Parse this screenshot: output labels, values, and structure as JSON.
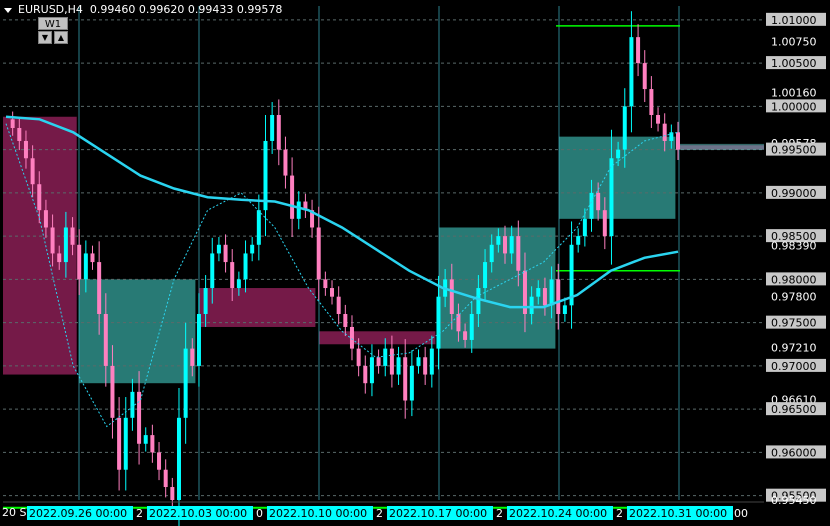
{
  "header": {
    "symbol": "EURUSD,H4",
    "ohlc": "0.99460 0.99620 0.99433 0.99578"
  },
  "timeframe_button": {
    "label": "W1",
    "down_icon": "arrow-down-icon",
    "up_icon": "arrow-up-icon"
  },
  "colors": {
    "bull": "#00ffff",
    "bear": "#ff80c0",
    "ma_slow": "#2ad4f0",
    "ma_fast": "#2ad4f0",
    "box_bull": "#2f8f8a",
    "box_bear": "#8a1f55",
    "grid": "#5a6a6a",
    "vline": "#3fb8c8",
    "level_line": "#00ff00",
    "price_label_bg": "#c8c8c8",
    "time_label_bg": "#00ffff"
  },
  "price_axis": {
    "levels": [
      "1.01000",
      "1.00750",
      "1.00500",
      "1.00160",
      "1.00000",
      "0.99578",
      "0.99500",
      "0.99000",
      "0.98500",
      "0.98390",
      "0.98000",
      "0.97800",
      "0.97500",
      "0.97210",
      "0.97000",
      "0.96610",
      "0.96500",
      "0.96000",
      "0.95500",
      "0.95450"
    ],
    "highlighted": [
      "1.01000",
      "1.00500",
      "1.00000",
      "0.99500",
      "0.99000",
      "0.98500",
      "0.98000",
      "0.97500",
      "0.97000",
      "0.96500",
      "0.96000",
      "0.95500"
    ],
    "current": "0.99578"
  },
  "time_axis": {
    "left_fragment": "20 S",
    "labels": [
      "2022.09.26 00:00",
      "2022.10.03 00:00",
      "2022.10.10 00:00",
      "2022.10.17 00:00",
      "2022.10.24 00:00",
      "2022.10.31 00:00"
    ],
    "fragments": [
      "2",
      "0",
      "2",
      "2",
      "2"
    ],
    "right_fragment": "00"
  },
  "chart_data": {
    "type": "candlestick",
    "symbol": "EURUSD",
    "timeframe": "H4",
    "ylim": [
      0.9545,
      1.0116
    ],
    "weeks": [
      {
        "start": "2022.09.19",
        "open": 0.9988,
        "close": 0.969,
        "high": 1.005,
        "low": 0.954
      },
      {
        "start": "2022.09.26",
        "open": 0.968,
        "close": 0.98,
        "high": 1.0,
        "low": 0.9535
      },
      {
        "start": "2022.10.03",
        "open": 0.979,
        "close": 0.9745,
        "high": 0.9998,
        "low": 0.974
      },
      {
        "start": "2022.10.10",
        "open": 0.974,
        "close": 0.9725,
        "high": 0.981,
        "low": 0.963
      },
      {
        "start": "2022.10.17",
        "open": 0.972,
        "close": 0.986,
        "high": 0.9875,
        "low": 0.97
      },
      {
        "start": "2022.10.24",
        "open": 0.987,
        "close": 0.9965,
        "high": 1.0093,
        "low": 0.981
      },
      {
        "start": "2022.10.31",
        "open": 0.9955,
        "close": 0.995,
        "high": 0.9995,
        "low": 0.993
      }
    ],
    "w1_levels": [
      1.0093,
      0.981,
      0.9536
    ],
    "series_path": [
      0.9985,
      0.9975,
      0.996,
      0.994,
      0.991,
      0.988,
      0.986,
      0.983,
      0.982,
      0.986,
      0.984,
      0.98,
      0.983,
      0.982,
      0.976,
      0.97,
      0.964,
      0.958,
      0.964,
      0.967,
      0.961,
      0.962,
      0.96,
      0.958,
      0.956,
      0.9545,
      0.964,
      0.972,
      0.97,
      0.976,
      0.979,
      0.983,
      0.984,
      0.982,
      0.979,
      0.98,
      0.983,
      0.984,
      0.988,
      0.996,
      0.999,
      0.995,
      0.992,
      0.987,
      0.989,
      0.988,
      0.986,
      0.98,
      0.979,
      0.978,
      0.976,
      0.9745,
      0.972,
      0.97,
      0.968,
      0.971,
      0.97,
      0.972,
      0.969,
      0.971,
      0.966,
      0.97,
      0.971,
      0.969,
      0.972,
      0.978,
      0.98,
      0.976,
      0.974,
      0.973,
      0.976,
      0.979,
      0.982,
      0.984,
      0.985,
      0.983,
      0.985,
      0.981,
      0.976,
      0.978,
      0.979,
      0.977,
      0.98,
      0.976,
      0.977,
      0.984,
      0.985,
      0.987,
      0.99,
      0.988,
      0.985,
      0.994,
      0.995,
      1.0,
      1.008,
      1.005,
      1.002,
      0.999,
      0.998,
      0.996,
      0.997,
      0.995
    ],
    "ma_slow": [
      0.9988,
      0.9985,
      0.997,
      0.9945,
      0.992,
      0.9905,
      0.9895,
      0.9892,
      0.989,
      0.988,
      0.986,
      0.9835,
      0.981,
      0.979,
      0.9778,
      0.9768,
      0.9768,
      0.9782,
      0.981,
      0.9825,
      0.9832
    ],
    "ma_fast": [
      0.998,
      0.987,
      0.97,
      0.963,
      0.966,
      0.98,
      0.988,
      0.99,
      0.986,
      0.979,
      0.974,
      0.971,
      0.9715,
      0.974,
      0.978,
      0.98,
      0.982,
      0.986,
      0.993,
      0.996,
      0.997
    ]
  }
}
